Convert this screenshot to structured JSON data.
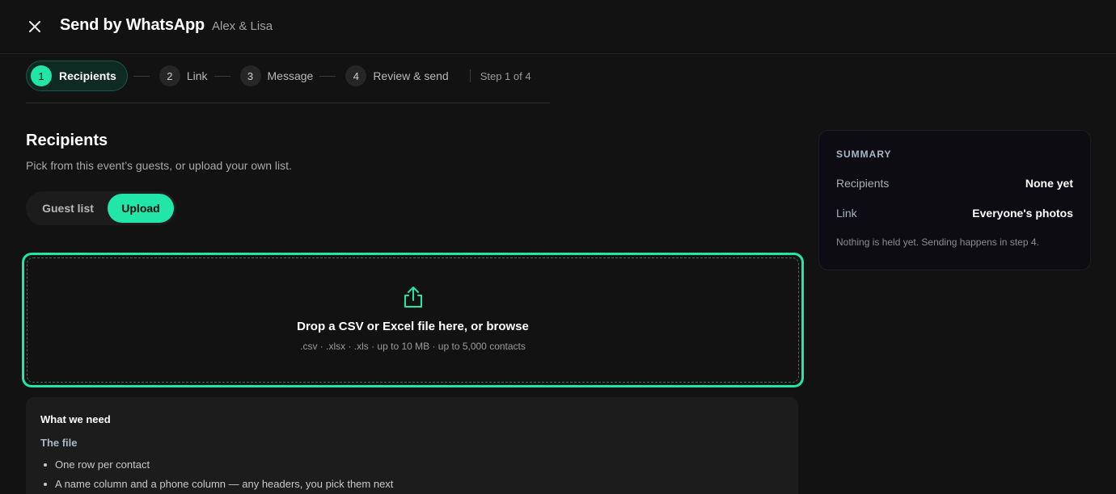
{
  "header": {
    "close_icon": "close-icon",
    "title": "Send by WhatsApp",
    "subtitle": "Alex & Lisa"
  },
  "stepper": {
    "steps": [
      {
        "num": "1",
        "label": "Recipients",
        "active": true
      },
      {
        "num": "2",
        "label": "Link",
        "active": false
      },
      {
        "num": "3",
        "label": "Message",
        "active": false
      },
      {
        "num": "4",
        "label": "Review & send",
        "active": false
      }
    ],
    "count": "Step 1 of 4"
  },
  "recipients": {
    "title": "Recipients",
    "description": "Pick from this event’s guests, or upload your own list.",
    "toggle": {
      "guest_list": "Guest list",
      "upload": "Upload",
      "selected": "Upload"
    }
  },
  "dropzone": {
    "icon": "upload-icon",
    "title": "Drop a CSV or Excel file here, or browse",
    "hint": ".csv · .xlsx · .xls · up to 10 MB · up to 5,000 contacts"
  },
  "requirements": {
    "title": "What we need",
    "subtitle": "The file",
    "items": [
      "One row per contact",
      "A name column and a phone column — any headers, you pick them next"
    ]
  },
  "summary": {
    "heading": "SUMMARY",
    "rows": [
      {
        "key": "Recipients",
        "value": "None yet"
      },
      {
        "key": "Link",
        "value": "Everyone's photos"
      }
    ],
    "note": "Nothing is held yet. Sending happens in step 4."
  },
  "colors": {
    "accent": "#22e6a8",
    "background": "#121212",
    "summary_bg": "#0c0c12"
  }
}
